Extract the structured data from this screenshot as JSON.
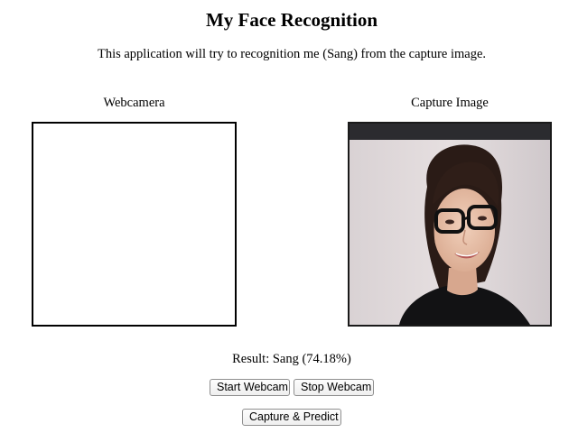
{
  "header": {
    "title": "My Face Recognition",
    "subtitle": "This application will try to recognition me (Sang) from the capture image."
  },
  "panels": {
    "webcam_label": "Webcamera",
    "capture_label": "Capture Image"
  },
  "result": {
    "text": "Result: Sang (74.18%)"
  },
  "buttons": {
    "start_webcam": "Start Webcam",
    "stop_webcam": "Stop Webcam",
    "capture_predict": "Capture & Predict"
  }
}
